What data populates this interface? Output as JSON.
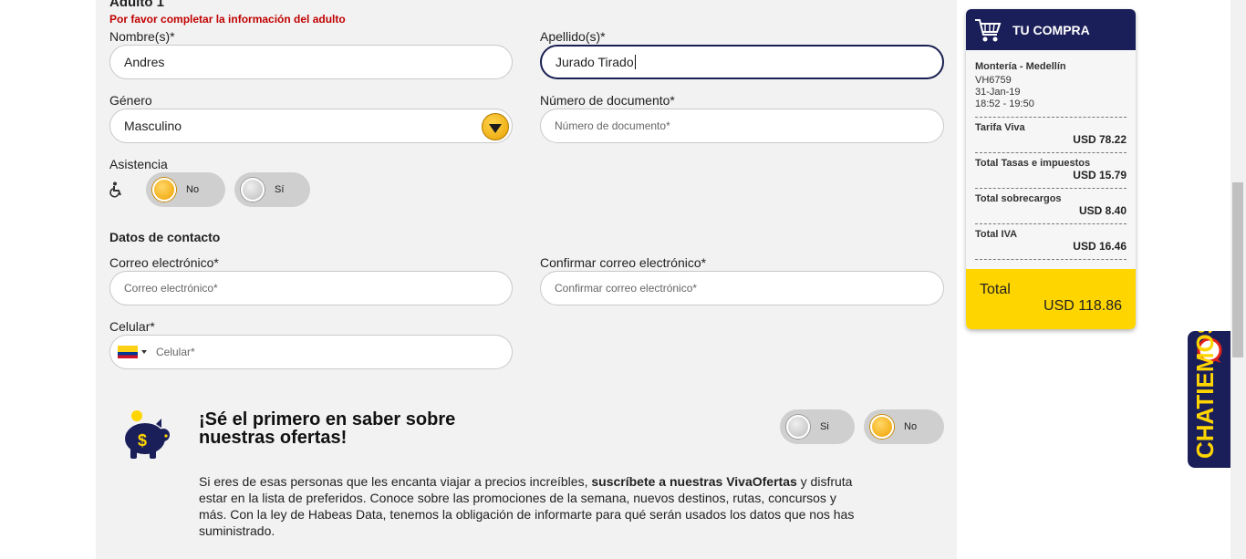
{
  "passenger": {
    "title": "Adulto 1",
    "error": "Por favor completar la información del adulto",
    "first_name_label": "Nombre(s)*",
    "first_name_value": "Andres",
    "last_name_label": "Apellido(s)*",
    "last_name_value": "Jurado Tirado",
    "gender_label": "Género",
    "gender_value": "Masculino",
    "doc_label": "Número de documento*",
    "doc_placeholder": "Número de documento*",
    "assistance_label": "Asistencia",
    "assistance_no": "No",
    "assistance_yes": "Sí"
  },
  "contact": {
    "title": "Datos de contacto",
    "email_label": "Correo electrónico*",
    "email_placeholder": "Correo electrónico*",
    "confirm_label": "Confirmar correo electrónico*",
    "confirm_placeholder": "Confirmar correo electrónico*",
    "phone_label": "Celular*",
    "phone_placeholder": "Celular*"
  },
  "promo": {
    "title_line1": "¡Sé el primero en saber sobre",
    "title_line2": "nuestras ofertas!",
    "yes": "Si",
    "no": "No",
    "text_a": "Si eres de esas personas que les encanta viajar a precios increíbles, ",
    "text_bold": "suscríbete a nuestras VivaOfertas",
    "text_b": " y disfruta estar en la lista de preferidos.  Conoce sobre las promociones de la semana, nuevos destinos, rutas, concursos y más. Con la ley de Habeas Data, tenemos la obligación de informarte para qué serán usados los datos que nos has suministrado."
  },
  "cart": {
    "title": "TU COMPRA",
    "route": "Montería - Medellín",
    "flight": "VH6759",
    "date": "31-Jan-19",
    "time": "18:52 - 19:50",
    "items": [
      {
        "label": "Tarifa Viva",
        "amount": "USD 78.22"
      },
      {
        "label": "Total Tasas e impuestos",
        "amount": "USD 15.79"
      },
      {
        "label": "Total sobrecargos",
        "amount": "USD 8.40"
      },
      {
        "label": "Total IVA",
        "amount": "USD 16.46"
      }
    ],
    "total_label": "Total",
    "total_amount": "USD 118.86"
  },
  "chat": {
    "label": "CHATIEMOS"
  },
  "colors": {
    "navy": "#1b1f59",
    "yellow": "#ffd500",
    "error": "#c00000"
  }
}
